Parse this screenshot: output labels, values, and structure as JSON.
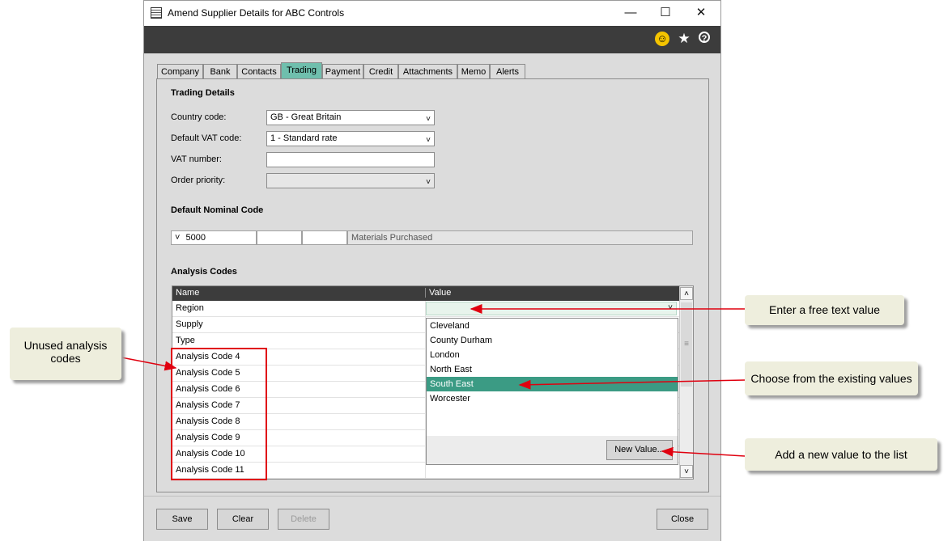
{
  "window": {
    "title": "Amend Supplier Details for ABC Controls",
    "controls": {
      "minimize": "—",
      "maximize": "☐",
      "close": "✕"
    }
  },
  "header_icons": {
    "smiley": "☺",
    "star": "★",
    "help": "?"
  },
  "tabs": [
    {
      "label": "Company"
    },
    {
      "label": "Bank"
    },
    {
      "label": "Contacts"
    },
    {
      "label": "Trading",
      "active": true
    },
    {
      "label": "Payment"
    },
    {
      "label": "Credit"
    },
    {
      "label": "Attachments"
    },
    {
      "label": "Memo"
    },
    {
      "label": "Alerts"
    }
  ],
  "trading_details": {
    "title": "Trading Details",
    "country_code": {
      "label": "Country code:",
      "value": "GB - Great Britain"
    },
    "default_vat_code": {
      "label": "Default VAT code:",
      "value": "1 - Standard rate"
    },
    "vat_number": {
      "label": "VAT number:",
      "value": ""
    },
    "order_priority": {
      "label": "Order priority:",
      "value": ""
    }
  },
  "default_nominal": {
    "title": "Default Nominal Code",
    "account": "5000",
    "cost_centre": "",
    "department": "",
    "description": "Materials Purchased"
  },
  "analysis_codes": {
    "title": "Analysis Codes",
    "columns": {
      "name": "Name",
      "value": "Value"
    },
    "rows": [
      {
        "name": "Region",
        "value": ""
      },
      {
        "name": "Supply",
        "value": ""
      },
      {
        "name": "Type",
        "value": ""
      },
      {
        "name": "Analysis Code 4",
        "value": ""
      },
      {
        "name": "Analysis Code 5",
        "value": ""
      },
      {
        "name": "Analysis Code 6",
        "value": ""
      },
      {
        "name": "Analysis Code 7",
        "value": ""
      },
      {
        "name": "Analysis Code 8",
        "value": ""
      },
      {
        "name": "Analysis Code 9",
        "value": ""
      },
      {
        "name": "Analysis Code 10",
        "value": ""
      },
      {
        "name": "Analysis Code 11",
        "value": ""
      }
    ],
    "dropdown_options": [
      "Cleveland",
      "County Durham",
      "London",
      "North East",
      "South East",
      "Worcester"
    ],
    "selected_option": "South East",
    "new_value_button": "New Value..."
  },
  "buttons": {
    "save": "Save",
    "clear": "Clear",
    "delete": "Delete",
    "close": "Close"
  },
  "callouts": {
    "unused": "Unused analysis codes",
    "free_text": "Enter a free text value",
    "existing": "Choose from the existing values",
    "new_value": "Add a new value to the list"
  },
  "colors": {
    "active_tab": "#6fbfad",
    "selected_item": "#3b9b84",
    "annotation_red": "#e0000f",
    "callout_bg": "#eeeedd"
  }
}
